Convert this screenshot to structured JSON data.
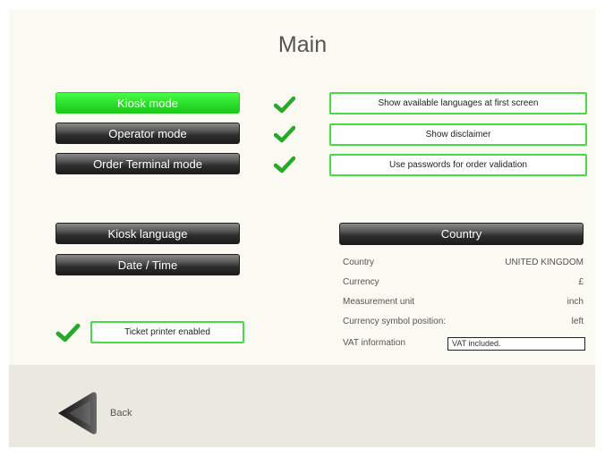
{
  "header": {
    "title": "Main"
  },
  "modes": [
    {
      "label": "Kiosk mode",
      "active": true
    },
    {
      "label": "Operator mode",
      "active": false
    },
    {
      "label": "Order Terminal mode",
      "active": false
    }
  ],
  "options": [
    {
      "label": "Show available languages at first screen",
      "checked": true
    },
    {
      "label": "Show disclaimer",
      "checked": true
    },
    {
      "label": "Use passwords for order validation",
      "checked": true
    }
  ],
  "settings_buttons": {
    "kiosk_language": "Kiosk language",
    "date_time": "Date / Time"
  },
  "country_panel": {
    "header": "Country",
    "rows": [
      {
        "label": "Country",
        "value": "UNITED KINGDOM"
      },
      {
        "label": "Currency",
        "value": "£"
      },
      {
        "label": "Measurement unit",
        "value": "inch"
      },
      {
        "label": "Currency symbol position:",
        "value": "left"
      }
    ],
    "vat_label": "VAT information",
    "vat_value": "VAT included."
  },
  "ticket_printer": {
    "label": "Ticket printer enabled",
    "checked": true
  },
  "footer": {
    "back_label": "Back"
  },
  "colors": {
    "accent_green": "#2ee02e",
    "check_green": "#2aa82a",
    "dark_button": "#2a2a2a",
    "footer_bg": "#ebe8df"
  },
  "icons": {
    "check": "checkmark-icon",
    "back": "back-arrow-icon"
  }
}
